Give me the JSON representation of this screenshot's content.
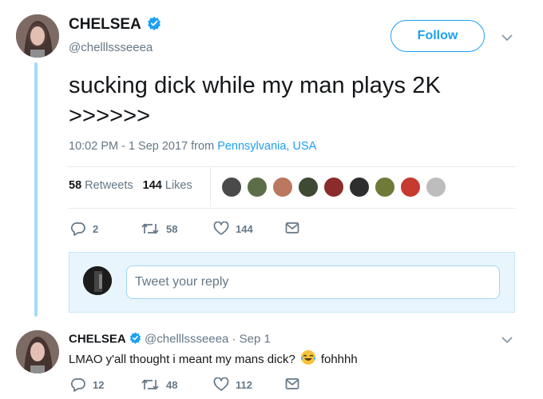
{
  "tweet": {
    "author_name": "CHELSEA",
    "author_handle": "@chelllssseeea",
    "follow_label": "Follow",
    "text_line1": "sucking dick while my man plays 2K",
    "text_line2": ">>>>>>",
    "time": "10:02 PM - 1 Sep 2017 from ",
    "location": "Pennsylvania, USA",
    "retweets_count": "58",
    "retweets_label": "Retweets",
    "likes_count": "144",
    "likes_label": "Likes",
    "actions": {
      "replies": "2",
      "retweets": "58",
      "likes": "144"
    }
  },
  "reply_box": {
    "placeholder": "Tweet your reply"
  },
  "reply": {
    "author_name": "CHELSEA",
    "author_handle": "@chelllssseeea",
    "date": "· Sep 1",
    "text": "LMAO y'all thought i meant my mans dick?",
    "text_after_emoji": "fohhhh",
    "actions": {
      "replies": "12",
      "retweets": "48",
      "likes": "112"
    }
  },
  "colors": {
    "accent": "#1da1f2",
    "thread": "#a3dbf7",
    "muted": "#657786"
  }
}
